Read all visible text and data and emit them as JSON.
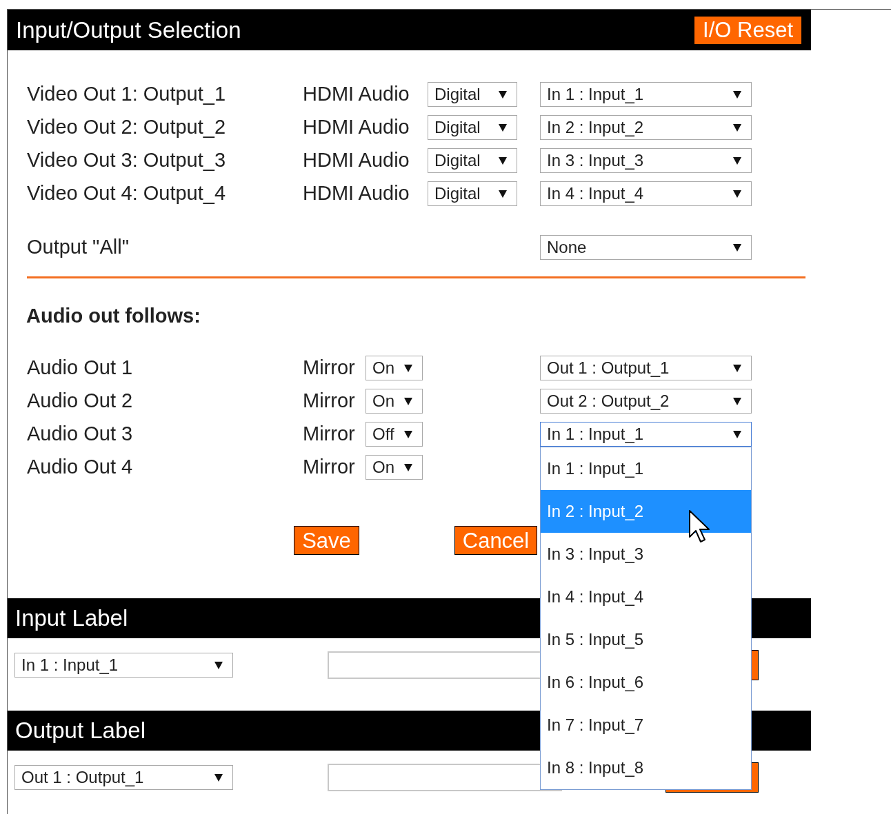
{
  "header": {
    "title": "Input/Output Selection",
    "reset_button": "I/O Reset"
  },
  "video_outputs": [
    {
      "label": "Video Out 1: Output_1",
      "audio_label": "HDMI Audio",
      "audio_mode": "Digital",
      "source": "In 1 : Input_1"
    },
    {
      "label": "Video Out 2: Output_2",
      "audio_label": "HDMI Audio",
      "audio_mode": "Digital",
      "source": "In 2 : Input_2"
    },
    {
      "label": "Video Out 3: Output_3",
      "audio_label": "HDMI Audio",
      "audio_mode": "Digital",
      "source": "In 3 : Input_3"
    },
    {
      "label": "Video Out 4: Output_4",
      "audio_label": "HDMI Audio",
      "audio_mode": "Digital",
      "source": "In 4 : Input_4"
    }
  ],
  "output_all": {
    "label": "Output \"All\"",
    "source": "None"
  },
  "audio_section": {
    "title": "Audio out follows:"
  },
  "audio_outputs": [
    {
      "label": "Audio Out 1",
      "mirror_label": "Mirror",
      "mirror": "On",
      "source": "Out 1 : Output_1",
      "open": false
    },
    {
      "label": "Audio Out 2",
      "mirror_label": "Mirror",
      "mirror": "On",
      "source": "Out 2 : Output_2",
      "open": false
    },
    {
      "label": "Audio Out 3",
      "mirror_label": "Mirror",
      "mirror": "Off",
      "source": "In 1 : Input_1",
      "open": true
    },
    {
      "label": "Audio Out 4",
      "mirror_label": "Mirror",
      "mirror": "On",
      "open": false
    }
  ],
  "buttons": {
    "save": "Save",
    "cancel": "Cancel"
  },
  "source_menu": {
    "items": [
      {
        "label": "In 1 : Input_1",
        "selected": false
      },
      {
        "label": "In 2 : Input_2",
        "selected": true
      },
      {
        "label": "In 3 : Input_3",
        "selected": false
      },
      {
        "label": "In 4 : Input_4",
        "selected": false
      },
      {
        "label": "In 5 : Input_5",
        "selected": false
      },
      {
        "label": "In 6 : Input_6",
        "selected": false
      },
      {
        "label": "In 7 : Input_7",
        "selected": false
      },
      {
        "label": "In 8 : Input_8",
        "selected": false
      }
    ]
  },
  "input_label": {
    "title": "Input Label",
    "selected": "In 1 : Input_1"
  },
  "output_label": {
    "title": "Output Label",
    "selected": "Out 1 : Output_1"
  }
}
